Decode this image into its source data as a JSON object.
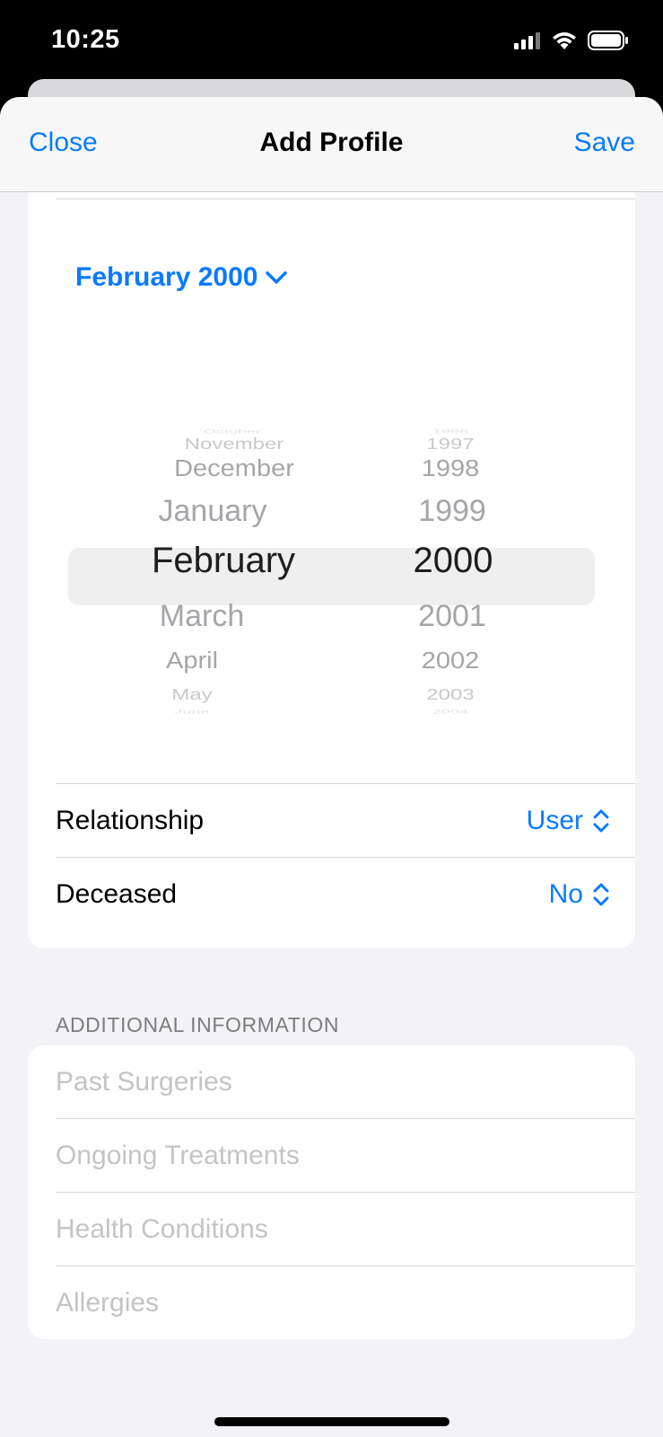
{
  "status_bar": {
    "time": "10:25",
    "icons": [
      "cellular-signal-icon",
      "wifi-icon",
      "battery-icon"
    ]
  },
  "nav": {
    "close_label": "Close",
    "title": "Add Profile",
    "save_label": "Save"
  },
  "date_picker": {
    "header_label": "February 2000",
    "months": {
      "above": [
        "October",
        "November",
        "December",
        "January"
      ],
      "selected": "February",
      "below": [
        "March",
        "April",
        "May",
        "June"
      ]
    },
    "years": {
      "above": [
        "1996",
        "1997",
        "1998",
        "1999"
      ],
      "selected": "2000",
      "below": [
        "2001",
        "2002",
        "2003",
        "2004"
      ]
    }
  },
  "rows": [
    {
      "label": "Relationship",
      "value": "User"
    },
    {
      "label": "Deceased",
      "value": "No"
    }
  ],
  "additional_info": {
    "header": "ADDITIONAL INFORMATION",
    "fields": [
      {
        "placeholder": "Past Surgeries"
      },
      {
        "placeholder": "Ongoing Treatments"
      },
      {
        "placeholder": "Health Conditions"
      },
      {
        "placeholder": "Allergies"
      }
    ]
  },
  "colors": {
    "accent": "#0a7aff",
    "background": "#f2f2f7",
    "placeholder": "#c4c4c7"
  }
}
